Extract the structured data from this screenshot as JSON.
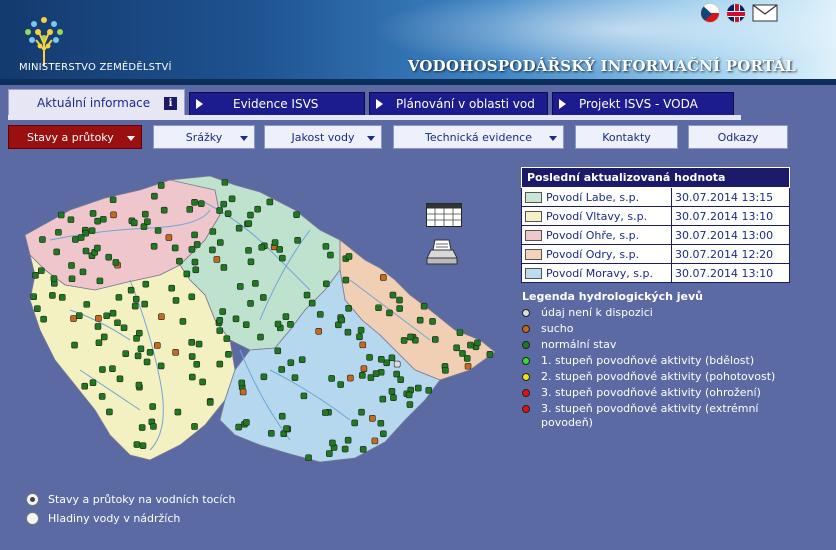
{
  "header": {
    "ministry": "MINISTERSTVO ZEMĚDĚLSTVÍ",
    "portal_title": "VODOHOSPODÁŘSKÝ INFORMAČNÍ PORTÁL"
  },
  "tabs": [
    {
      "label": "Aktuální informace",
      "active": true
    },
    {
      "label": "Evidence ISVS"
    },
    {
      "label": "Plánování v oblasti vod"
    },
    {
      "label": "Projekt ISVS - VODA"
    }
  ],
  "submenu": [
    {
      "label": "Stavy a průtoky",
      "dropdown": true,
      "active": true
    },
    {
      "label": "Srážky",
      "dropdown": true
    },
    {
      "label": "Jakost vody",
      "dropdown": true
    },
    {
      "label": "Technická evidence",
      "dropdown": true
    },
    {
      "label": "Kontakty"
    },
    {
      "label": "Odkazy"
    }
  ],
  "last_update": {
    "title": "Poslední aktualizovaná hodnota",
    "rows": [
      {
        "name": "Povodí Labe, s.p.",
        "time": "30.07.2014 13:15",
        "color": "#c9e6d4"
      },
      {
        "name": "Povodí Vltavy, s.p.",
        "time": "30.07.2014 13:10",
        "color": "#f4f1c4"
      },
      {
        "name": "Povodí Ohře, s.p.",
        "time": "30.07.2014 13:00",
        "color": "#f0c8cc"
      },
      {
        "name": "Povodí Odry, s.p.",
        "time": "30.07.2014 12:20",
        "color": "#f2d2b8"
      },
      {
        "name": "Povodí Moravy, s.p.",
        "time": "30.07.2014 13:10",
        "color": "#bcdcf0"
      }
    ]
  },
  "legend": {
    "title": "Legenda hydrologických jevů",
    "items": [
      {
        "label": "údaj není k dispozici",
        "color": "#dddddd"
      },
      {
        "label": "sucho",
        "color": "#c46a1a"
      },
      {
        "label": "normální stav",
        "color": "#1e7a1e"
      },
      {
        "label": "1. stupeň povodňové aktivity (bdělost)",
        "color": "#33dd33"
      },
      {
        "label": "2. stupeň povodňové aktivity (pohotovost)",
        "color": "#f0e020"
      },
      {
        "label": "3. stupeň povodňové aktivity (ohrožení)",
        "color": "#e01010"
      },
      {
        "label": "3. stupeň povodňové aktivity (extrémní povodeň)",
        "color": "#e01010"
      }
    ]
  },
  "radios": [
    {
      "label": "Stavy a průtoky na vodních tocích",
      "checked": true
    },
    {
      "label": "Hladiny vody v nádržích",
      "checked": false
    }
  ],
  "map": {
    "regions": {
      "labe": "#bfe2cf",
      "vltava": "#f3f0c2",
      "ohre": "#eec6cb",
      "odra": "#f0cfb5",
      "morava": "#b5d8ee"
    },
    "station_colors": {
      "normal": "#1e7a1e",
      "drought": "#c46a1a",
      "na": "#dddddd"
    }
  }
}
